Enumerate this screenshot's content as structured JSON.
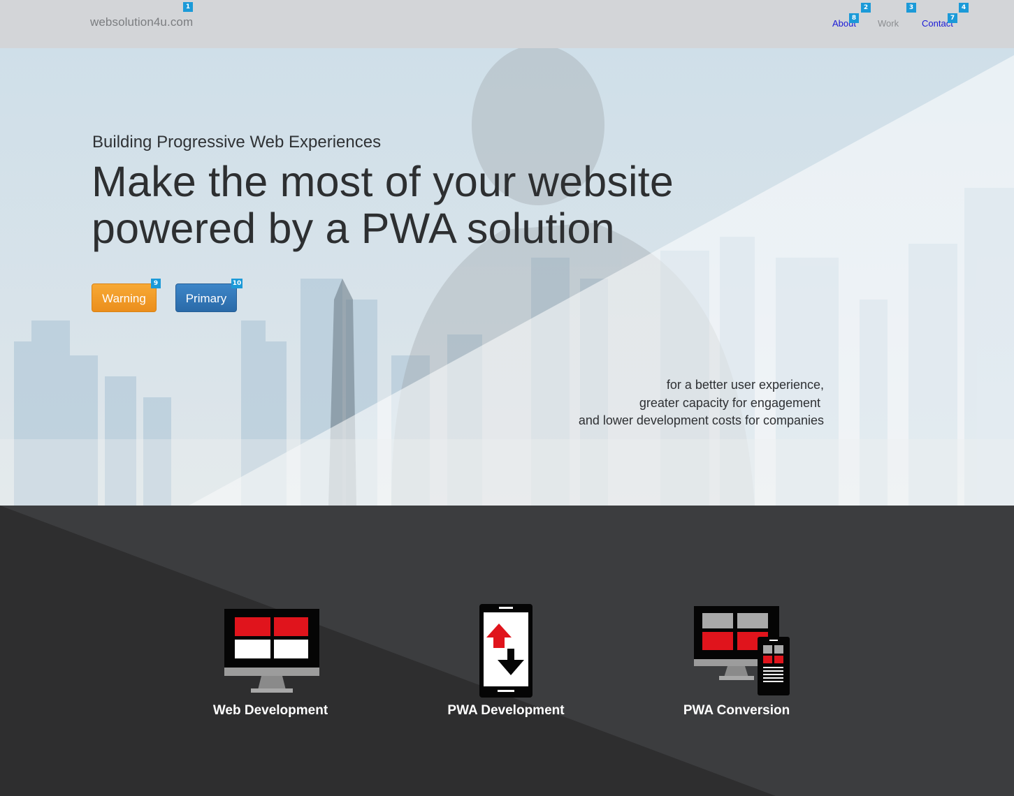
{
  "navbar": {
    "brand": "websolution4u.com",
    "links": [
      {
        "label": "About"
      },
      {
        "label": "Work"
      },
      {
        "label": "Contact"
      }
    ]
  },
  "markers": [
    "1",
    "2",
    "3",
    "4",
    "7",
    "8",
    "9",
    "10"
  ],
  "hero": {
    "subtitle": "Building Progressive Web Experiences",
    "headline_line1": "Make the most of your website",
    "headline_line2": "powered by a PWA solution",
    "buttons": {
      "warning_label": "Warning",
      "primary_label": "Primary"
    },
    "tagline": [
      "for a better user experience,",
      "greater capacity for engagement ",
      "and lower development costs for companies"
    ]
  },
  "services": [
    {
      "label": "Web Development",
      "icon": "desktop-monitor-icon"
    },
    {
      "label": "PWA Development",
      "icon": "smartphone-up-down-arrows-icon"
    },
    {
      "label": "PWA Conversion",
      "icon": "monitor-and-phone-icon"
    }
  ],
  "colors": {
    "accent_red": "#e0141c",
    "warning": "#f0961f",
    "primary": "#337ab7",
    "marker": "#1b9ad8",
    "dark_bg": "#2e2e2f"
  }
}
